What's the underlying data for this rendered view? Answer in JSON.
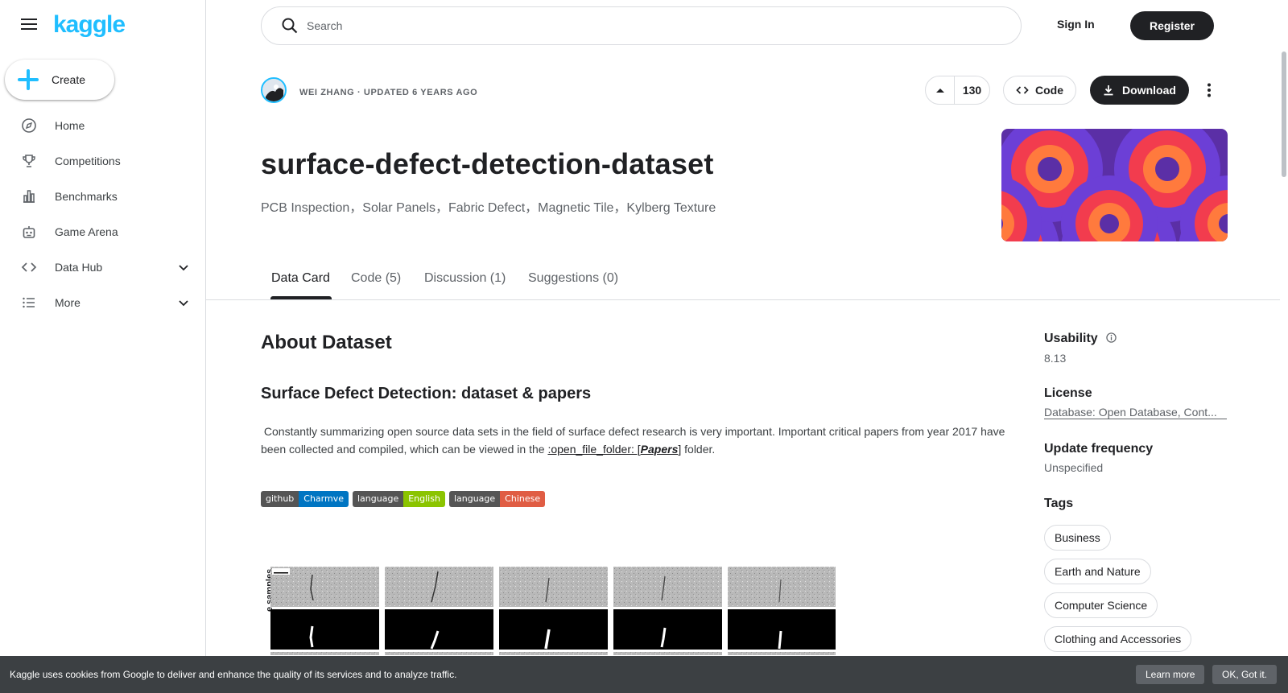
{
  "sidebar": {
    "logo": "kaggle",
    "create_label": "Create",
    "items": [
      {
        "label": "Home",
        "icon": "compass-icon"
      },
      {
        "label": "Competitions",
        "icon": "trophy-icon"
      },
      {
        "label": "Benchmarks",
        "icon": "bar-chart-icon"
      },
      {
        "label": "Game Arena",
        "icon": "robot-icon"
      },
      {
        "label": "Data Hub",
        "icon": "code-icon"
      },
      {
        "label": "More",
        "icon": "list-icon"
      }
    ]
  },
  "topbar": {
    "search_placeholder": "Search",
    "signin": "Sign In",
    "register": "Register"
  },
  "dataset": {
    "byline": "WEI ZHANG · UPDATED 6 YEARS AGO",
    "votes": "130",
    "code_label": "Code",
    "download_label": "Download",
    "title": "surface-defect-detection-dataset",
    "subtitle": "PCB Inspection，Solar Panels，Fabric Defect，Magnetic Tile，Kylberg Texture"
  },
  "tabs": [
    {
      "label": "Data Card"
    },
    {
      "label": "Code (5)"
    },
    {
      "label": "Discussion (1)"
    },
    {
      "label": "Suggestions (0)"
    }
  ],
  "content": {
    "about_heading": "About Dataset",
    "section_heading": "Surface Defect Detection: dataset & papers",
    "para_prefix": "⁣⁣ Constantly summarizing open source data sets in the field of surface defect research is very important. Important critical papers from year 2017 have been collected and compiled, which can be viewed in the ",
    "para_link_text": ":open_file_folder: [",
    "para_link_papers": "Papers",
    "para_link_close": "]",
    "para_suffix": " folder. ⁣",
    "badges": [
      {
        "left": "github",
        "right": "Charmve",
        "color": "#0075c2"
      },
      {
        "left": "language",
        "right": "English",
        "color": "#8bc400"
      },
      {
        "left": "language",
        "right": "Chinese",
        "color": "#e05d44"
      }
    ],
    "samples_label": "e samples"
  },
  "details": {
    "usability_label": "Usability",
    "usability_value": "8.13",
    "license_label": "License",
    "license_value": "Database: Open Database, Cont...",
    "update_label": "Update frequency",
    "update_value": "Unspecified",
    "tags_label": "Tags",
    "tags": [
      "Business",
      "Earth and Nature",
      "Computer Science",
      "Clothing and Accessories"
    ]
  },
  "cookie": {
    "text": "Kaggle uses cookies from Google to deliver and enhance the quality of its services and to analyze traffic.",
    "learn_more": "Learn more",
    "ok": "OK, Got it."
  },
  "colors": {
    "brand": "#20beff",
    "dark": "#202124"
  }
}
